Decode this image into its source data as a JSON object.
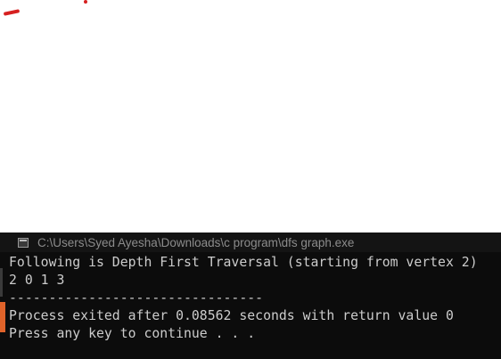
{
  "console_window": {
    "title": "C:\\Users\\Syed Ayesha\\Downloads\\c program\\dfs graph.exe",
    "icon": "console-app-icon"
  },
  "output_lines": [
    "Following is Depth First Traversal (starting from vertex 2)",
    "2 0 1 3",
    "--------------------------------",
    "Process exited after 0.08562 seconds with return value 0",
    "Press any key to continue . . ."
  ],
  "colors": {
    "console_background": "#0c0c0c",
    "console_text": "#cccccc",
    "title_text": "#8c8c8c",
    "annotation_red": "#d62020",
    "side_accent": "#e0632a"
  }
}
